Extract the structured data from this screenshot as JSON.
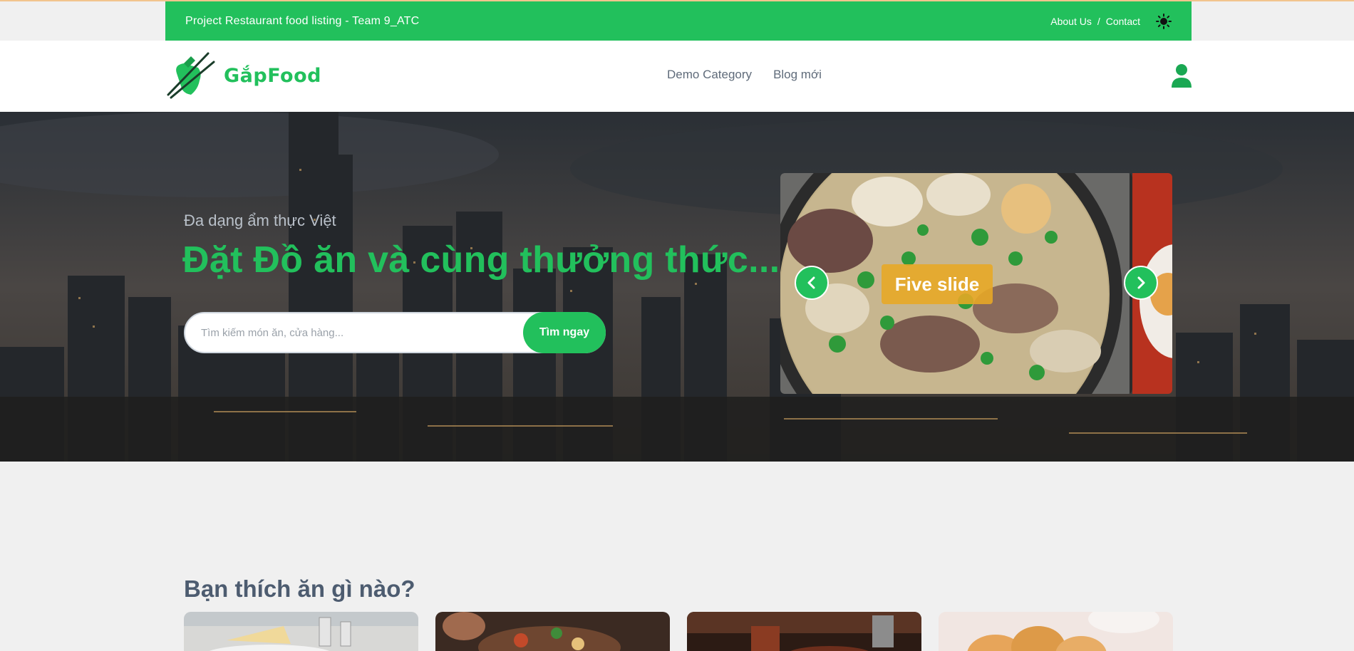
{
  "topbar": {
    "title": "Project Restaurant food listing - Team 9_ATC",
    "links": [
      "About Us",
      "Contact"
    ],
    "separator": "/",
    "theme_icon": "sun-icon"
  },
  "navbar": {
    "logo_text": "GắpFood",
    "links": [
      "Demo Category",
      "Blog mới"
    ],
    "account_icon": "user-icon"
  },
  "hero": {
    "subtitle": "Đa dạng ẩm thực Việt",
    "title": "Đặt Đồ ăn và cùng thưởng thức...",
    "search": {
      "placeholder": "Tìm kiếm món ăn, cửa hàng...",
      "button": "Tìm ngay"
    },
    "carousel": {
      "caption": "Five slide",
      "prev_icon": "chevron-left-icon",
      "next_icon": "chevron-right-icon"
    }
  },
  "section": {
    "title": "Bạn thích ăn gì nào?"
  },
  "colors": {
    "brand": "#22c05c",
    "caption_bg": "#e8a824",
    "heading": "#4d5c70"
  }
}
